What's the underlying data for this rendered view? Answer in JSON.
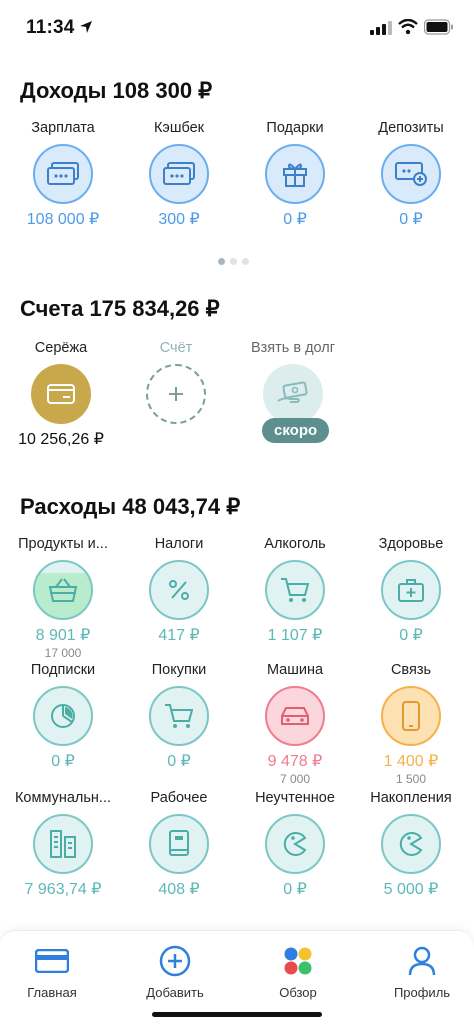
{
  "status_bar": {
    "time": "11:34"
  },
  "income": {
    "title": "Доходы 108 300 ₽",
    "items": [
      {
        "label": "Зарплата",
        "amount": "108 000 ₽",
        "icon": "cash-icon"
      },
      {
        "label": "Кэшбек",
        "amount": "300 ₽",
        "icon": "cash-icon"
      },
      {
        "label": "Подарки",
        "amount": "0 ₽",
        "icon": "gift-icon"
      },
      {
        "label": "Депозиты",
        "amount": "0 ₽",
        "icon": "deposit-icon"
      }
    ],
    "pager": {
      "pages": 3,
      "active": 1
    }
  },
  "accounts": {
    "title": "Счета 175 834,26 ₽",
    "items": [
      {
        "label": "Серёжа",
        "amount": "10 256,26 ₽"
      },
      {
        "label": "Счёт"
      },
      {
        "label": "Взять в долг",
        "badge": "скоро"
      }
    ]
  },
  "expenses": {
    "title": "Расходы 48 043,74 ₽",
    "items": [
      {
        "label": "Продукты и...",
        "amount": "8 901 ₽",
        "sub": "17 000",
        "icon": "basket-icon"
      },
      {
        "label": "Налоги",
        "amount": "417 ₽",
        "icon": "percent-icon"
      },
      {
        "label": "Алкоголь",
        "amount": "1 107 ₽",
        "icon": "cart-icon"
      },
      {
        "label": "Здоровье",
        "amount": "0 ₽",
        "icon": "medkit-icon"
      },
      {
        "label": "Подписки",
        "amount": "0 ₽",
        "icon": "pie-chart-icon"
      },
      {
        "label": "Покупки",
        "amount": "0 ₽",
        "icon": "cart-icon"
      },
      {
        "label": "Машина",
        "amount": "9 478 ₽",
        "sub": "7 000",
        "icon": "car-icon"
      },
      {
        "label": "Связь",
        "amount": "1 400 ₽",
        "sub": "1 500",
        "icon": "phone-icon"
      },
      {
        "label": "Коммунальн...",
        "amount": "7 963,74 ₽",
        "icon": "building-icon"
      },
      {
        "label": "Рабочее",
        "amount": "408 ₽",
        "icon": "book-icon"
      },
      {
        "label": "Неучтенное",
        "amount": "0 ₽",
        "icon": "pacman-icon"
      },
      {
        "label": "Накопления",
        "amount": "5 000 ₽",
        "icon": "pacman-icon"
      }
    ]
  },
  "colors": {
    "income_accent": "#4a9ce8",
    "expense_accent": "#5bb9b6",
    "over_budget": "#f07d8e",
    "near_budget": "#f4b24a",
    "account_gold": "#c9a84c",
    "badge": "#5c8f8e"
  },
  "tabbar": {
    "items": [
      {
        "label": "Главная",
        "icon": "card-icon"
      },
      {
        "label": "Добавить",
        "icon": "plus-circle-icon"
      },
      {
        "label": "Обзор",
        "icon": "dots-icon"
      },
      {
        "label": "Профиль",
        "icon": "user-icon"
      }
    ]
  }
}
